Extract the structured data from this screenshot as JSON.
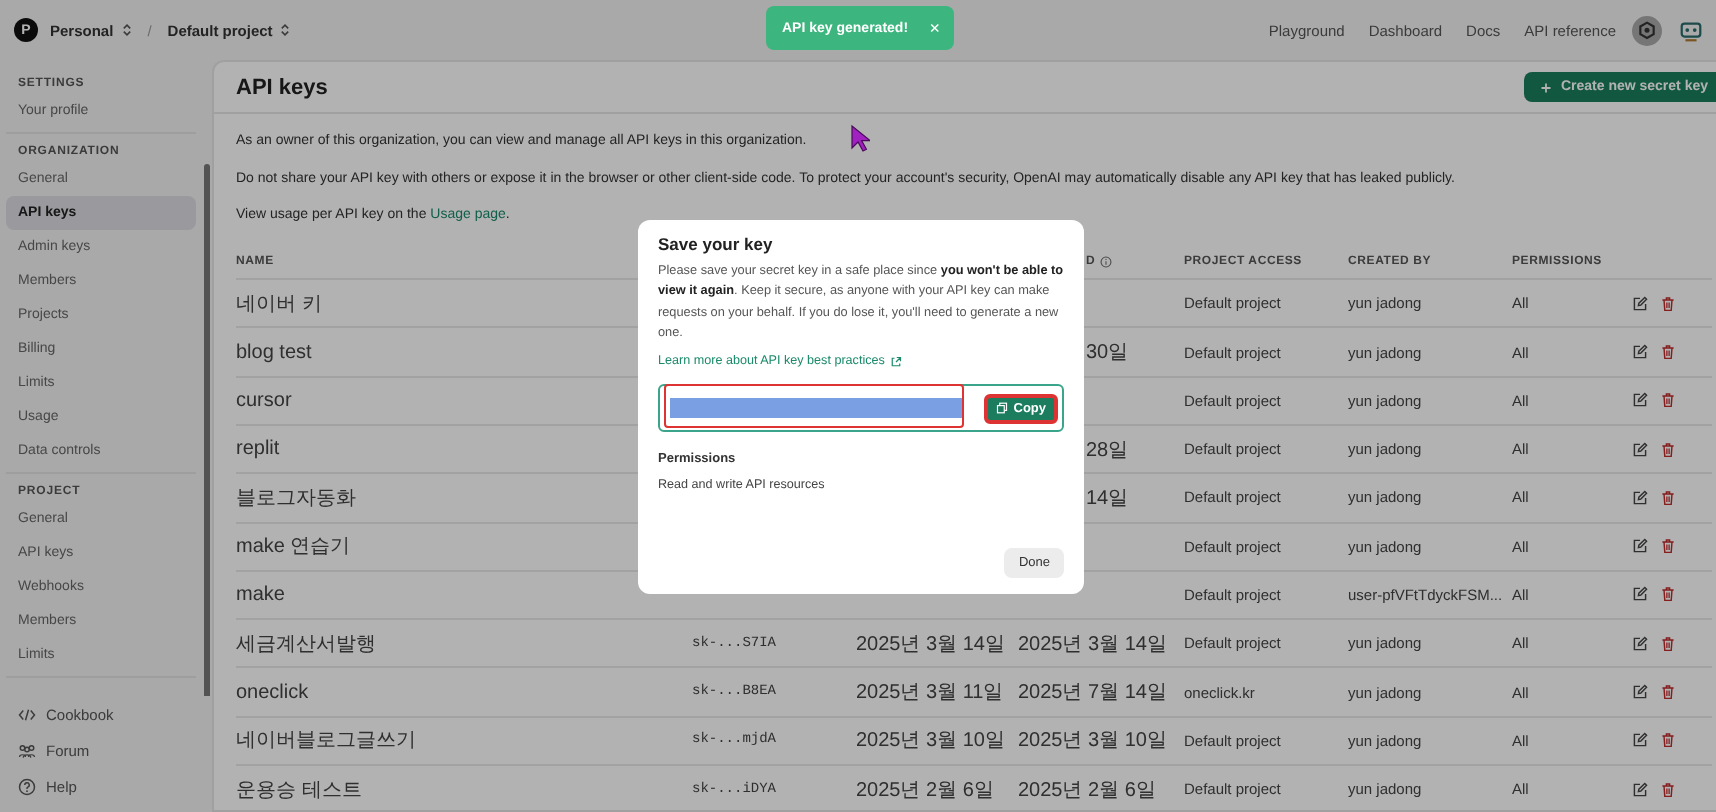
{
  "topbar": {
    "logo": "P",
    "org": "Personal",
    "separator": "/",
    "project": "Default project",
    "nav": [
      "Playground",
      "Dashboard",
      "Docs",
      "API reference"
    ]
  },
  "toast": {
    "text": "API key generated!",
    "close": "×"
  },
  "sidebar": {
    "sections": [
      {
        "heading": "SETTINGS",
        "items": [
          {
            "label": "Your profile",
            "selected": false
          }
        ]
      },
      {
        "heading": "ORGANIZATION",
        "items": [
          {
            "label": "General",
            "selected": false
          },
          {
            "label": "API keys",
            "selected": true
          },
          {
            "label": "Admin keys",
            "selected": false
          },
          {
            "label": "Members",
            "selected": false
          },
          {
            "label": "Projects",
            "selected": false
          },
          {
            "label": "Billing",
            "selected": false
          },
          {
            "label": "Limits",
            "selected": false
          },
          {
            "label": "Usage",
            "selected": false
          },
          {
            "label": "Data controls",
            "selected": false
          }
        ]
      },
      {
        "heading": "PROJECT",
        "items": [
          {
            "label": "General",
            "selected": false
          },
          {
            "label": "API keys",
            "selected": false
          },
          {
            "label": "Webhooks",
            "selected": false
          },
          {
            "label": "Members",
            "selected": false
          },
          {
            "label": "Limits",
            "selected": false
          }
        ]
      }
    ],
    "footer": [
      {
        "kind": "cookbook",
        "label": "Cookbook"
      },
      {
        "kind": "forum",
        "label": "Forum"
      },
      {
        "kind": "help",
        "label": "Help"
      }
    ]
  },
  "page": {
    "title": "API keys",
    "create_button": "Create new secret key",
    "intro": [
      "As an owner of this organization, you can view and manage all API keys in this organization.",
      "Do not share your API key with others or expose it in the browser or other client-side code. To protect your account's security, OpenAI may automatically disable any API key that has leaked publicly."
    ],
    "usage_text": "View usage per API key on the ",
    "usage_link": "Usage page",
    "usage_after": "."
  },
  "table": {
    "header": {
      "name": "NAME",
      "last_used_fragment": "D",
      "project_access": "PROJECT ACCESS",
      "created_by": "CREATED BY",
      "permissions": "PERMISSIONS"
    },
    "rows": [
      {
        "name": "네이버 키",
        "project_access": "Default project",
        "created_by": "yun jadong",
        "permissions": "All"
      },
      {
        "name": "blog test",
        "last_used": "30일",
        "project_access": "Default project",
        "created_by": "yun jadong",
        "permissions": "All"
      },
      {
        "name": "cursor",
        "project_access": "Default project",
        "created_by": "yun jadong",
        "permissions": "All"
      },
      {
        "name": "replit",
        "last_used": "28일",
        "project_access": "Default project",
        "created_by": "yun jadong",
        "permissions": "All"
      },
      {
        "name": "블로그자동화",
        "last_used": "14일",
        "project_access": "Default project",
        "created_by": "yun jadong",
        "permissions": "All"
      },
      {
        "name": "make 연습기",
        "project_access": "Default project",
        "created_by": "yun jadong",
        "permissions": "All"
      },
      {
        "name": "make",
        "project_access": "Default project",
        "created_by": "user-pfVFtTdyckFSM...",
        "permissions": "All"
      },
      {
        "name": "세금계산서발행",
        "secret_key": "sk-...S7IA",
        "created": "2025년 3월 14일",
        "last_used": "2025년 3월 14일",
        "project_access": "Default project",
        "created_by": "yun jadong",
        "permissions": "All"
      },
      {
        "name": "oneclick",
        "secret_key": "sk-...B8EA",
        "created": "2025년 3월 11일",
        "last_used": "2025년 7월 14일",
        "project_access": "oneclick.kr",
        "created_by": "yun jadong",
        "permissions": "All"
      },
      {
        "name": "네이버블로그글쓰기",
        "secret_key": "sk-...mjdA",
        "created": "2025년 3월 10일",
        "last_used": "2025년 3월 10일",
        "project_access": "Default project",
        "created_by": "yun jadong",
        "permissions": "All"
      },
      {
        "name": "운용승 테스트",
        "secret_key": "sk-...iDYA",
        "created": "2025년 2월 6일",
        "last_used": "2025년 2월 6일",
        "project_access": "Default project",
        "created_by": "yun jadong",
        "permissions": "All"
      }
    ]
  },
  "modal": {
    "title": "Save your key",
    "text": "Please save your secret key in a safe place since **you won't be able to view it again**. Keep it secure, as anyone with your API key can make requests on your behalf. If you do lose it, you'll need to generate a new one.",
    "link": "Learn more about API key best practices",
    "copy_button": "Copy",
    "permissions_label": "Permissions",
    "permissions_value": "Read and write API resources",
    "done_button": "Done"
  }
}
